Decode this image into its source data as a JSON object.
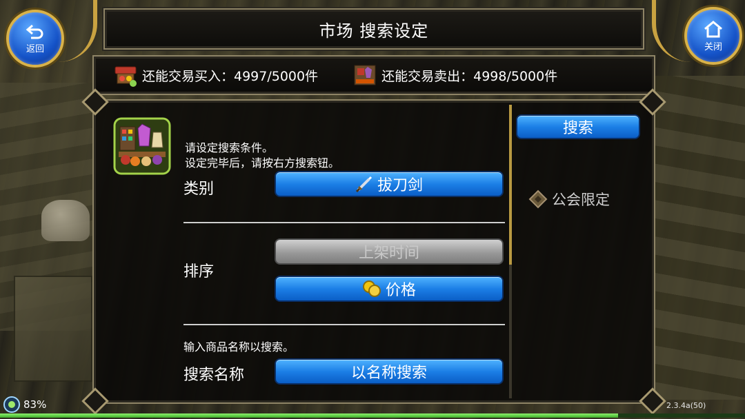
{
  "header": {
    "title": "市场 搜索设定"
  },
  "nav": {
    "back_label": "返回",
    "close_label": "关闭"
  },
  "trade": {
    "buy_label": "还能交易买入：4997/5000件",
    "sell_label": "还能交易卖出：4998/5000件"
  },
  "panel": {
    "instruction_line1": "请设定搜索条件。",
    "instruction_line2": "设定完毕后，请按右方搜索钮。",
    "category_label": "类别",
    "category_value": "拔刀剑",
    "sort_label": "排序",
    "sort_option_time": "上架时间",
    "sort_option_price": "价格",
    "name_instruction": "输入商品名称以搜索。",
    "name_label": "搜索名称",
    "name_button": "以名称搜索",
    "search_button": "搜索",
    "guild_label": "公会限定"
  },
  "status": {
    "percent": "83%",
    "progress_fraction": 0.83,
    "version": "2.3.4a(50)"
  },
  "colors": {
    "button_blue": "#1c7fe6",
    "button_gray": "#9a9a9a",
    "frame_gold": "#c9a241"
  }
}
